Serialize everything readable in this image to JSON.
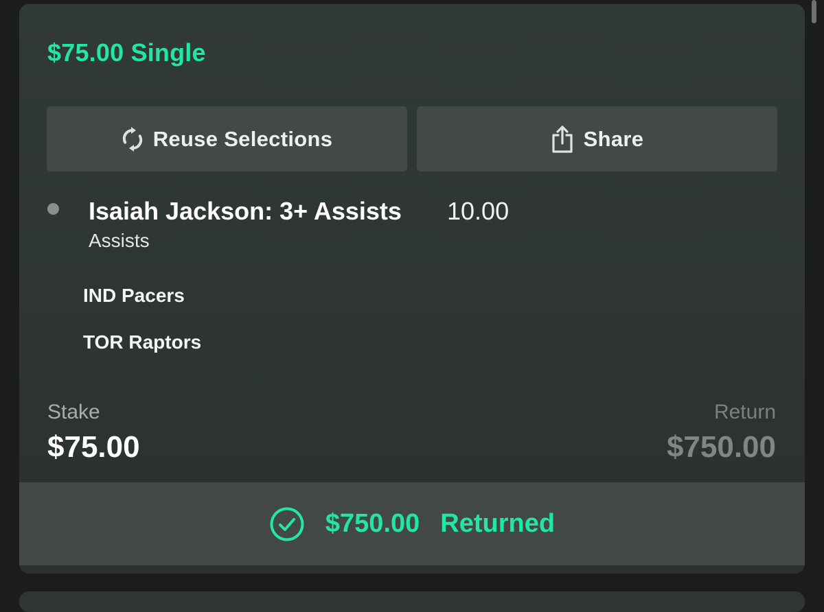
{
  "bet": {
    "title": "$75.00 Single"
  },
  "actions": {
    "reuse_label": "Reuse Selections",
    "reuse_icon": "refresh-icon",
    "share_label": "Share",
    "share_icon": "share-icon"
  },
  "selection": {
    "name": "Isaiah Jackson: 3+ Assists",
    "odds": "10.00",
    "market": "Assists",
    "teams": [
      "IND Pacers",
      "TOR Raptors"
    ]
  },
  "totals": {
    "stake_label": "Stake",
    "stake_value": "$75.00",
    "return_label": "Return",
    "return_value": "$750.00"
  },
  "result": {
    "icon": "check-circle-icon",
    "amount": "$750.00",
    "status": "Returned"
  },
  "colors": {
    "accent": "#22e6a4",
    "card": "#2f3634",
    "button": "#434946"
  }
}
